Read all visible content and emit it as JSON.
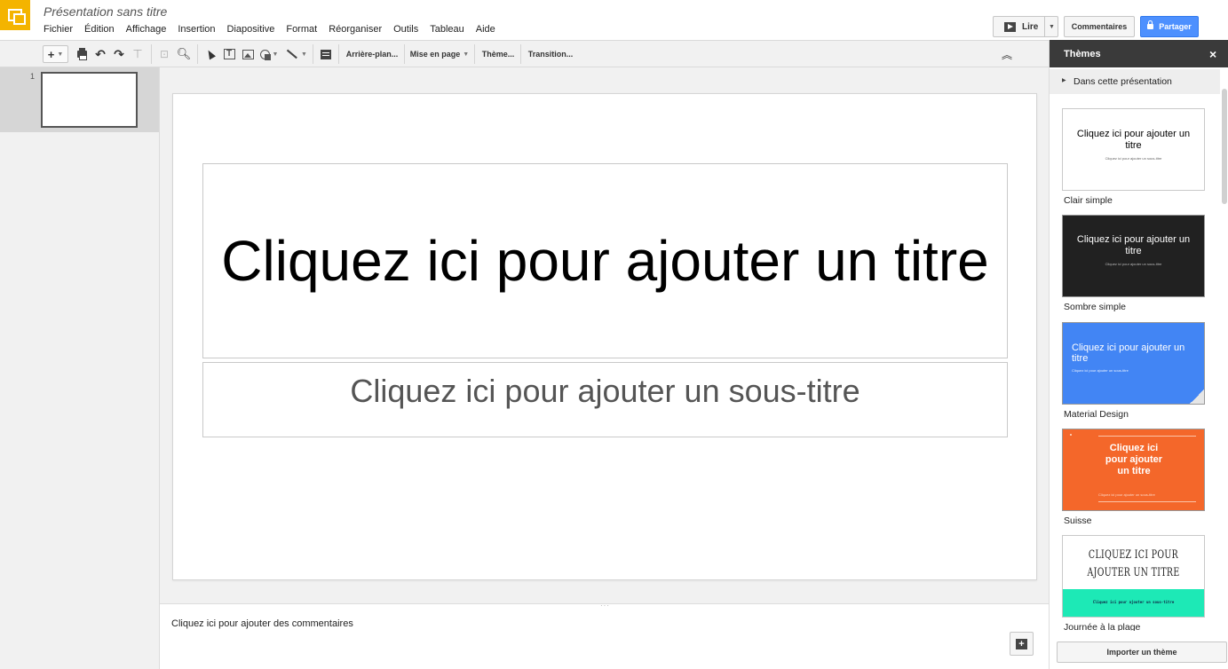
{
  "app": {
    "title": "Présentation sans titre",
    "brand_color": "#f4b400"
  },
  "menu": [
    "Fichier",
    "Édition",
    "Affichage",
    "Insertion",
    "Diapositive",
    "Format",
    "Réorganiser",
    "Outils",
    "Tableau",
    "Aide"
  ],
  "header_actions": {
    "present_label": "Lire",
    "comments_label": "Commentaires",
    "share_label": "Partager",
    "share_color": "#4d90fe"
  },
  "toolbar": {
    "new_slide_label": "+",
    "background_label": "Arrière-plan...",
    "layout_label": "Mise en page",
    "theme_label": "Thème...",
    "transition_label": "Transition..."
  },
  "filmstrip": {
    "slides": [
      {
        "number": "1"
      }
    ]
  },
  "slide": {
    "title_placeholder": "Cliquez ici pour ajouter un titre",
    "subtitle_placeholder": "Cliquez ici pour ajouter un sous-titre"
  },
  "notes": {
    "placeholder": "Cliquez ici pour ajouter des commentaires"
  },
  "themes_panel": {
    "title": "Thèmes",
    "close_icon": "×",
    "section_label": "Dans cette présentation",
    "import_label": "Importer un thème",
    "themes": [
      {
        "name": "Clair simple",
        "preview_title": "Cliquez ici pour ajouter un titre",
        "preview_subtitle": "Cliquez ici pour ajouter un sous-titre",
        "bg": "#ffffff"
      },
      {
        "name": "Sombre simple",
        "preview_title": "Cliquez ici pour ajouter un titre",
        "preview_subtitle": "Cliquez ici pour ajouter un sous-titre",
        "bg": "#212121"
      },
      {
        "name": "Material Design",
        "preview_title": "Cliquez ici pour ajouter un titre",
        "preview_subtitle": "Cliquez ici pour ajouter un sous-titre",
        "bg": "#4285f4"
      },
      {
        "name": "Suisse",
        "preview_title": "Cliquez ici pour ajouter un titre",
        "preview_subtitle": "Cliquez ici pour ajouter un sous-titre",
        "bg": "#f4672a"
      },
      {
        "name": "Journée à la plage",
        "preview_title": "CLIQUEZ ICI POUR AJOUTER UN TITRE",
        "preview_subtitle": "Cliquez ici pour ajouter un sous-titre",
        "bg": "#1de9b6"
      }
    ]
  }
}
